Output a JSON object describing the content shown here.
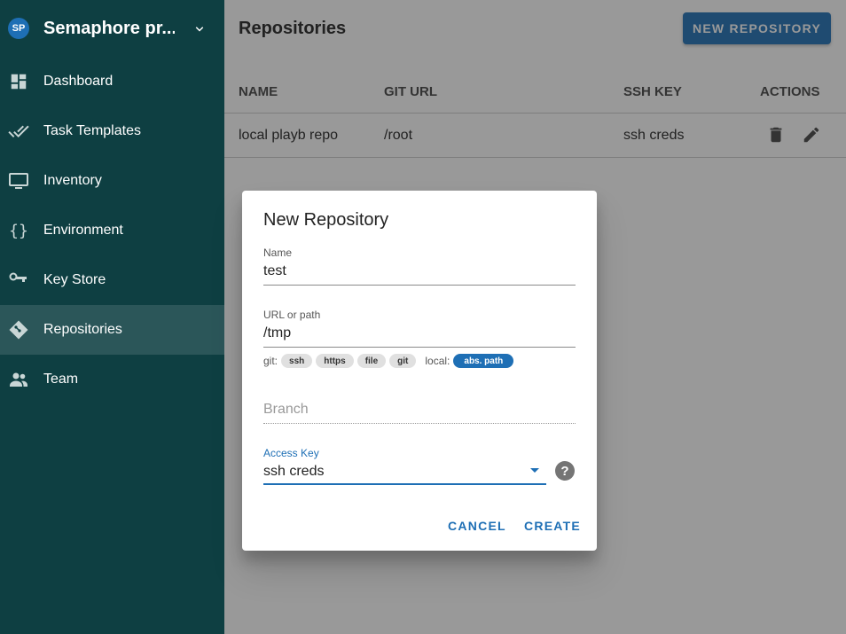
{
  "sidebar": {
    "avatar": "SP",
    "project_name": "Semaphore pr...",
    "items": [
      {
        "label": "Dashboard",
        "icon": "dashboard-icon"
      },
      {
        "label": "Task Templates",
        "icon": "done-all-icon"
      },
      {
        "label": "Inventory",
        "icon": "monitor-icon"
      },
      {
        "label": "Environment",
        "icon": "braces-icon"
      },
      {
        "label": "Key Store",
        "icon": "key-icon"
      },
      {
        "label": "Repositories",
        "icon": "git-icon",
        "active": true
      },
      {
        "label": "Team",
        "icon": "people-icon"
      }
    ]
  },
  "main": {
    "title": "Repositories",
    "new_button": "NEW REPOSITORY",
    "columns": [
      "NAME",
      "GIT URL",
      "SSH KEY",
      "ACTIONS"
    ],
    "rows": [
      {
        "name": "local playb repo",
        "git_url": "/root",
        "ssh_key": "ssh creds"
      }
    ]
  },
  "dialog": {
    "title": "New Repository",
    "name_label": "Name",
    "name_value": "test",
    "url_label": "URL or path",
    "url_value": "/tmp",
    "git_prefix": "git:",
    "git_chips": [
      "ssh",
      "https",
      "file",
      "git"
    ],
    "local_prefix": "local:",
    "local_chip": "abs. path",
    "branch_placeholder": "Branch",
    "access_key_label": "Access Key",
    "access_key_value": "ssh creds",
    "help_symbol": "?",
    "cancel": "CANCEL",
    "create": "CREATE"
  },
  "colors": {
    "sidebar_bg": "#0e3f42",
    "accent": "#1e6fb5"
  }
}
